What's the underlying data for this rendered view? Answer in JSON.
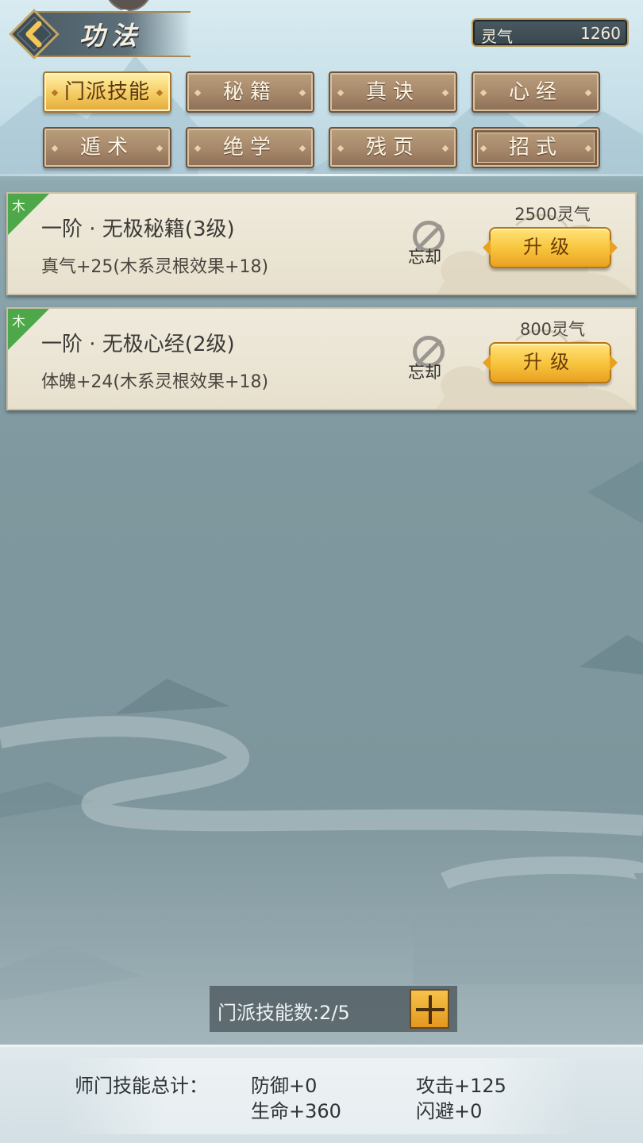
{
  "header": {
    "title": "功法",
    "back_icon": "chevron-left-icon",
    "currency": {
      "label": "灵气",
      "value": "1260"
    }
  },
  "tabs": [
    {
      "label": "门派技能",
      "active": true
    },
    {
      "label": "秘籍",
      "active": false
    },
    {
      "label": "真诀",
      "active": false
    },
    {
      "label": "心经",
      "active": false
    },
    {
      "label": "遁术",
      "active": false
    },
    {
      "label": "绝学",
      "active": false
    },
    {
      "label": "残页",
      "active": false
    },
    {
      "label": "招式",
      "active": false
    }
  ],
  "skills": [
    {
      "element": "木",
      "title": "一阶 · 无极秘籍(3级)",
      "desc": "真气+25(木系灵根效果+18)",
      "forget_label": "忘却",
      "cost": "2500灵气",
      "upgrade_label": "升级"
    },
    {
      "element": "木",
      "title": "一阶 · 无极心经(2级)",
      "desc": "体魄+24(木系灵根效果+18)",
      "forget_label": "忘却",
      "cost": "800灵气",
      "upgrade_label": "升级"
    }
  ],
  "skill_count": {
    "text": "门派技能数:2/5"
  },
  "summary": {
    "label": "师门技能总计：",
    "stats": [
      "防御+0",
      "攻击+125",
      "生命+360",
      "闪避+0"
    ]
  },
  "colors": {
    "accent_gold": "#f5cc62",
    "element_wood": "#4da84a",
    "tab_brown": "#a6876a"
  }
}
